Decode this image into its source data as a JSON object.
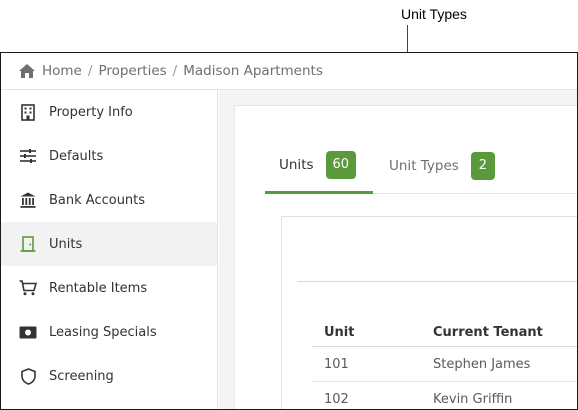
{
  "callout": {
    "label": "Unit Types"
  },
  "breadcrumb": {
    "items": [
      "Home",
      "Properties",
      "Madison Apartments"
    ],
    "separator": "/"
  },
  "sidebar": {
    "items": [
      {
        "label": "Property Info",
        "icon": "building-icon"
      },
      {
        "label": "Defaults",
        "icon": "sliders-icon"
      },
      {
        "label": "Bank Accounts",
        "icon": "bank-icon"
      },
      {
        "label": "Units",
        "icon": "door-icon",
        "active": true
      },
      {
        "label": "Rentable Items",
        "icon": "cart-icon"
      },
      {
        "label": "Leasing Specials",
        "icon": "money-icon"
      },
      {
        "label": "Screening",
        "icon": "shield-icon"
      }
    ]
  },
  "tabs": [
    {
      "label": "Units",
      "count": "60",
      "active": true
    },
    {
      "label": "Unit Types",
      "count": "2"
    }
  ],
  "table": {
    "headers": [
      "Unit",
      "Current Tenant"
    ],
    "rows": [
      [
        "101",
        "Stephen James"
      ],
      [
        "102",
        "Kevin Griffin"
      ]
    ]
  },
  "colors": {
    "accent": "#5a9a3c",
    "active_row": "#f2f2f2",
    "main_bg": "#f4f4f4"
  }
}
